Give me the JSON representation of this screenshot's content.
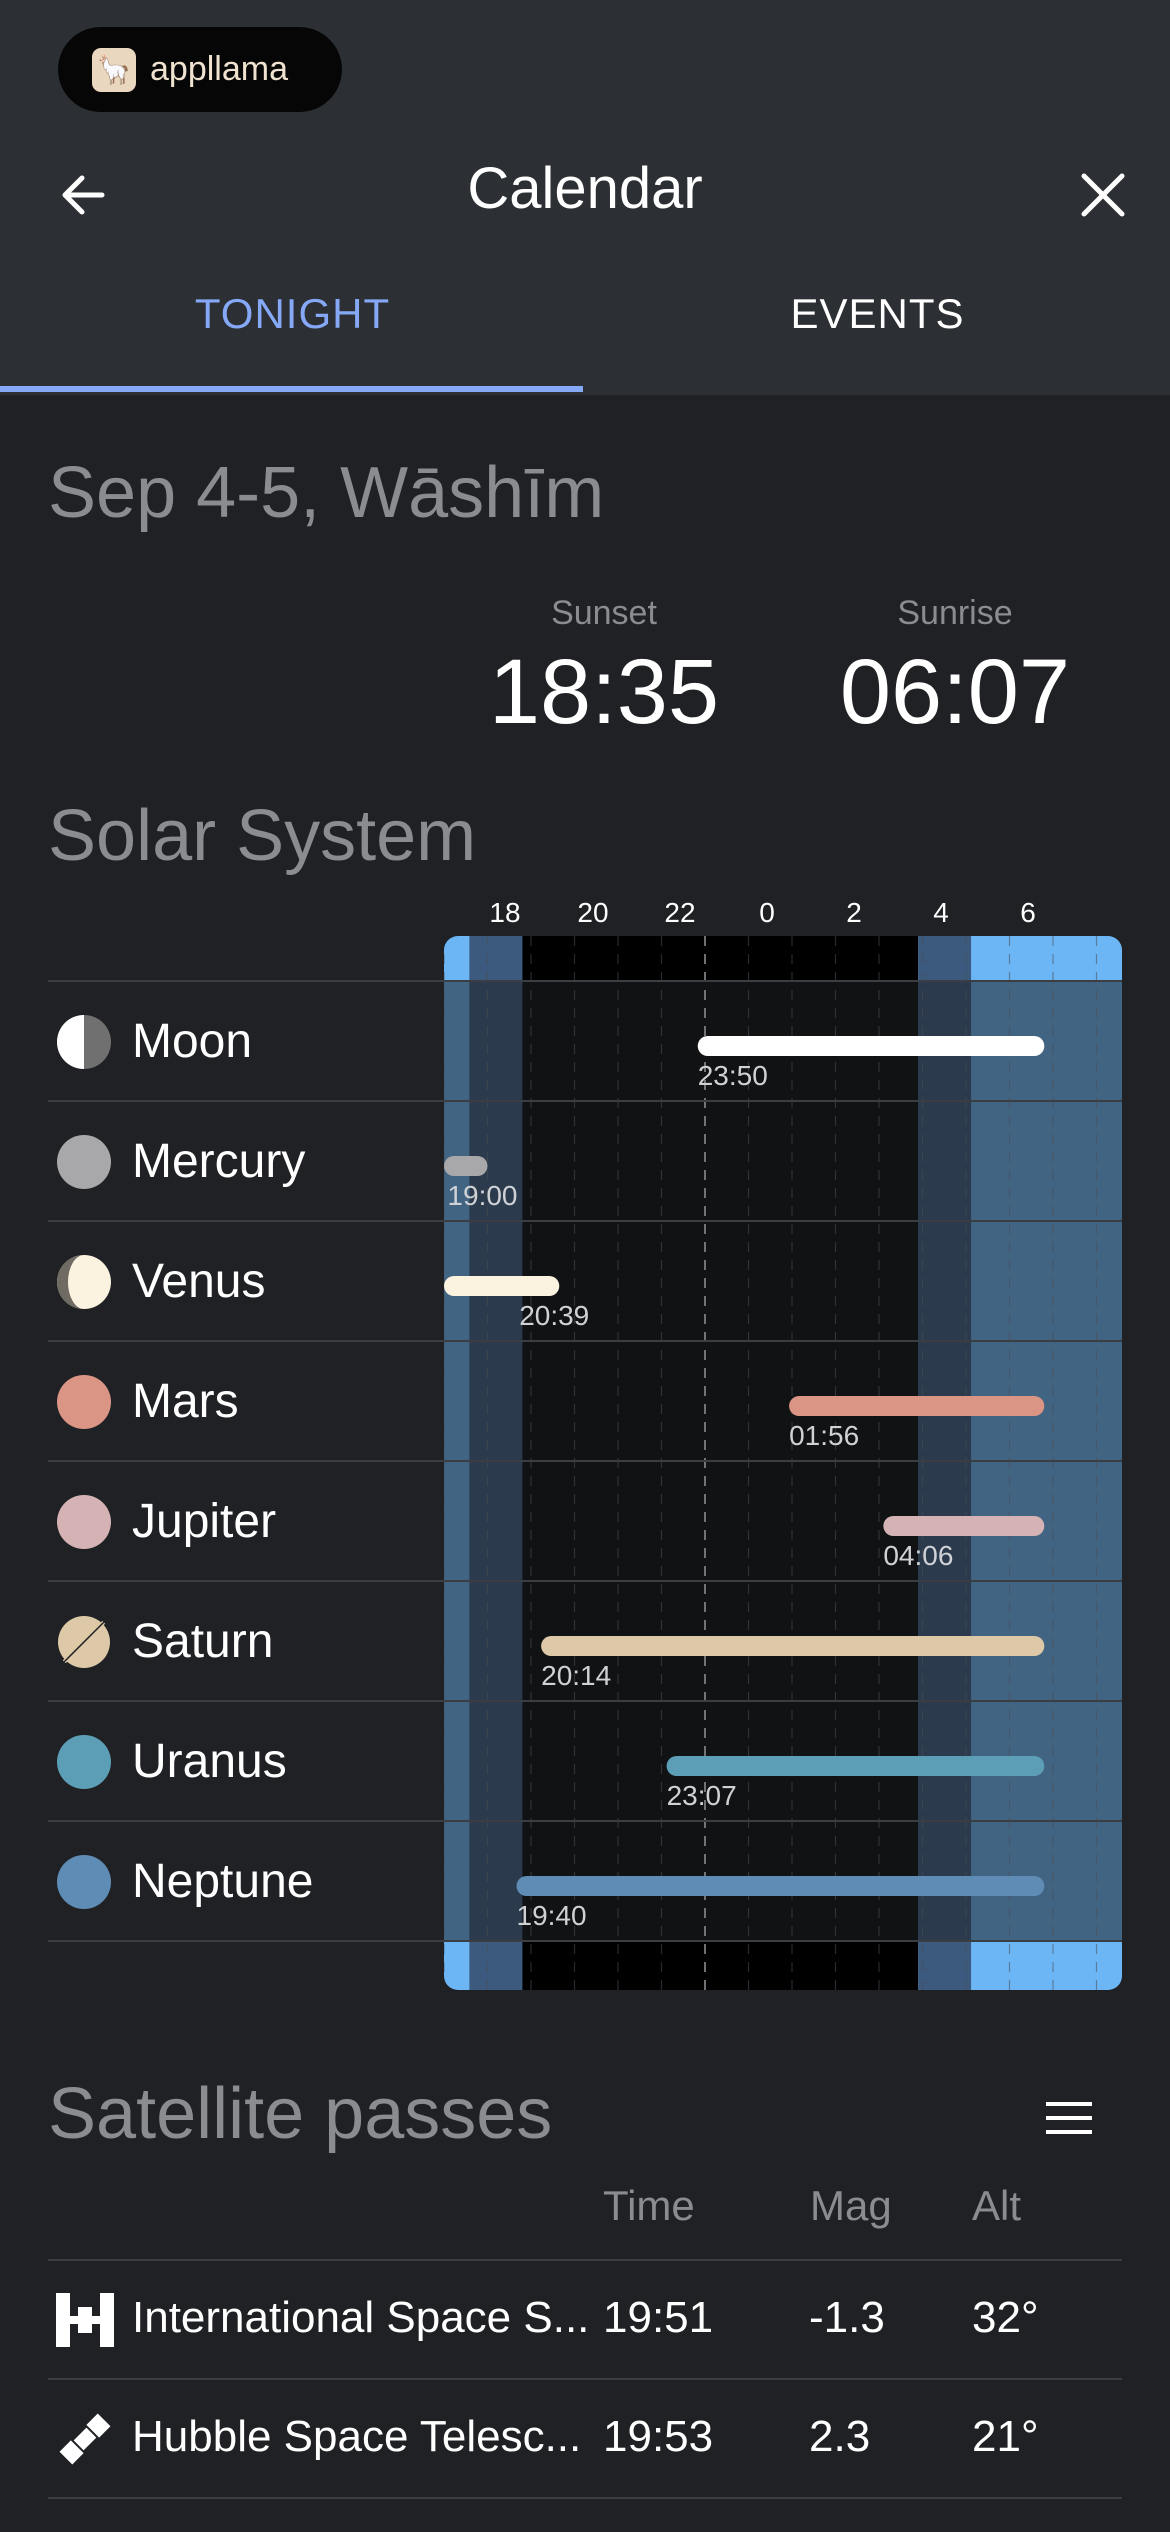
{
  "badge": {
    "text": "appllama"
  },
  "header": {
    "title": "Calendar",
    "back_icon": "arrow-left-icon",
    "close_icon": "close-icon"
  },
  "tabs": [
    {
      "label": "TONIGHT",
      "active": true
    },
    {
      "label": "EVENTS",
      "active": false
    }
  ],
  "date_title": "Sep 4-5, Wāshīm",
  "sun": {
    "sunset_label": "Sunset",
    "sunset_time": "18:35",
    "sunrise_label": "Sunrise",
    "sunrise_time": "06:07"
  },
  "solar_system": {
    "title": "Solar System",
    "ticks": [
      "18",
      "20",
      "22",
      "0",
      "2",
      "4",
      "6"
    ],
    "chart_data": {
      "type": "gantt",
      "axis_start_hour": 18,
      "axis_end_hour": 7.8,
      "twilight": {
        "sunset_hour": 18.583,
        "dark_start_hour": 19.8,
        "dark_end_hour": 4.9,
        "sunrise_hour": 6.117
      },
      "bodies": [
        {
          "name": "Moon",
          "rise_label": "23:50",
          "start": 23.833,
          "end": 31.8,
          "color": "#ffffff"
        },
        {
          "name": "Mercury",
          "rise_label": "19:00",
          "start": 18.0,
          "end": 19.0,
          "color": "#a8a8aa"
        },
        {
          "name": "Venus",
          "rise_label": "20:39",
          "start": 18.0,
          "end": 20.65,
          "color": "#fbf2df"
        },
        {
          "name": "Mars",
          "rise_label": "01:56",
          "start": 25.933,
          "end": 31.8,
          "color": "#db9585"
        },
        {
          "name": "Jupiter",
          "rise_label": "04:06",
          "start": 28.1,
          "end": 31.8,
          "color": "#d5b3b5"
        },
        {
          "name": "Saturn",
          "rise_label": "20:14",
          "start": 20.233,
          "end": 31.8,
          "color": "#ddc9a7"
        },
        {
          "name": "Uranus",
          "rise_label": "23:07",
          "start": 23.117,
          "end": 31.8,
          "color": "#5c9eb5"
        },
        {
          "name": "Neptune",
          "rise_label": "19:40",
          "start": 19.667,
          "end": 31.8,
          "color": "#5e8cb5"
        }
      ]
    }
  },
  "satellites": {
    "title": "Satellite passes",
    "menu_icon": "menu-icon",
    "columns": [
      "Time",
      "Mag",
      "Alt"
    ],
    "rows": [
      {
        "name": "International Space S...",
        "time": "19:51",
        "mag": "-1.3",
        "alt": "32°",
        "icon": "space-station-icon"
      },
      {
        "name": "Hubble Space Telesc...",
        "time": "19:53",
        "mag": "2.3",
        "alt": "21°",
        "icon": "satellite-icon"
      }
    ]
  }
}
